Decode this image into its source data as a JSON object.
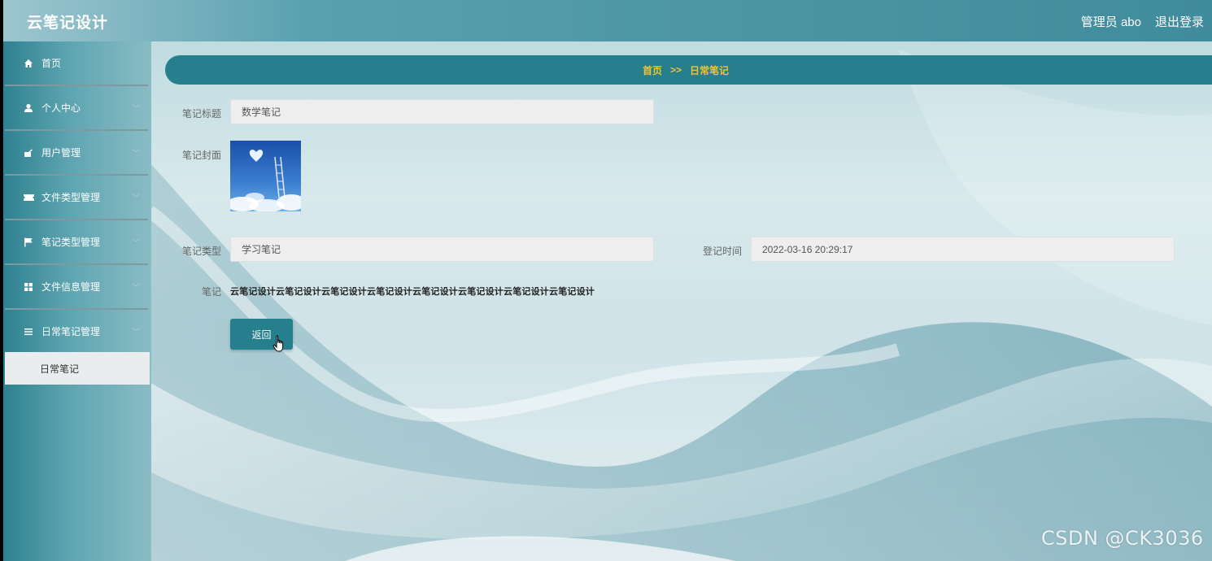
{
  "header": {
    "app_title": "云笔记设计",
    "admin_label": "管理员 abo",
    "logout_label": "退出登录"
  },
  "sidebar": {
    "items": [
      {
        "label": "首页",
        "icon": "home-icon"
      },
      {
        "label": "个人中心",
        "icon": "user-icon"
      },
      {
        "label": "用户管理",
        "icon": "users-icon"
      },
      {
        "label": "文件类型管理",
        "icon": "ticket-icon"
      },
      {
        "label": "笔记类型管理",
        "icon": "flag-icon"
      },
      {
        "label": "文件信息管理",
        "icon": "grid-icon"
      },
      {
        "label": "日常笔记管理",
        "icon": "list-icon"
      }
    ],
    "expanded_subitem": "日常笔记",
    "arrow_glyph": "﹀"
  },
  "breadcrumb": {
    "home": "首页",
    "separator": ">>",
    "current": "日常笔记"
  },
  "form": {
    "title_label": "笔记标题",
    "title_value": "数学笔记",
    "cover_label": "笔记封面",
    "type_label": "笔记类型",
    "type_value": "学习笔记",
    "time_label": "登记时间",
    "time_value": "2022-03-16 20:29:17",
    "note_label": "笔记",
    "note_value": "云笔记设计云笔记设计云笔记设计云笔记设计云笔记设计云笔记设计云笔记设计云笔记设计",
    "back_button_label": "返回"
  },
  "colors": {
    "accent": "#257f8d",
    "breadcrumb_text": "#f1c232"
  },
  "watermark": "CSDN @CK3036"
}
